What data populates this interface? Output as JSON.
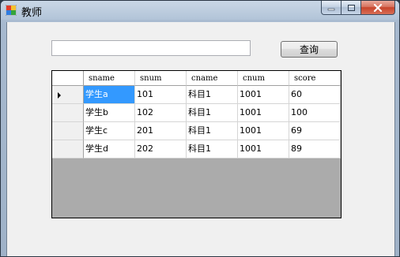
{
  "window": {
    "title": "教师"
  },
  "search": {
    "value": "",
    "placeholder": ""
  },
  "toolbar": {
    "query_label": "查询"
  },
  "grid": {
    "columns": [
      "sname",
      "snum",
      "cname",
      "cnum",
      "score"
    ],
    "rows": [
      [
        "学生a",
        "101",
        "科目1",
        "1001",
        "60"
      ],
      [
        "学生b",
        "102",
        "科目1",
        "1001",
        "100"
      ],
      [
        "学生c",
        "201",
        "科目1",
        "1001",
        "69"
      ],
      [
        "学生d",
        "202",
        "科目1",
        "1001",
        "89"
      ]
    ],
    "selected_row": 0,
    "selected_col": 0
  },
  "colors": {
    "selection": "#3399ff",
    "grid_background": "#ababab",
    "client_background": "#f0f0f0"
  },
  "icons": {
    "app_icon": "app-icon",
    "minimize": "minimize-icon",
    "maximize": "maximize-icon",
    "close": "close-icon",
    "current_row": "current-row-arrow-icon"
  }
}
